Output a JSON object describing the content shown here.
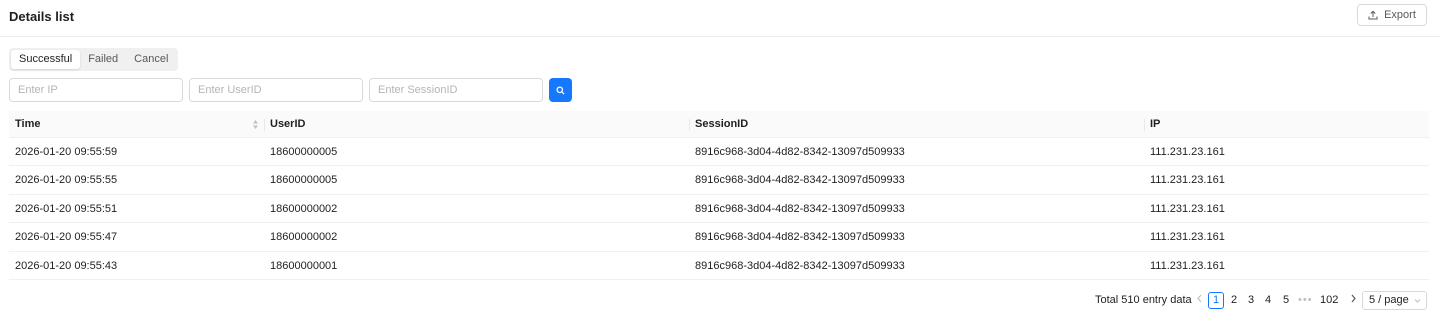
{
  "header": {
    "title": "Details list",
    "export_label": "Export"
  },
  "segmented": [
    {
      "label": "Successful",
      "active": true
    },
    {
      "label": "Failed",
      "active": false
    },
    {
      "label": "Cancel",
      "active": false
    }
  ],
  "filters": {
    "ip_placeholder": "Enter IP",
    "userid_placeholder": "Enter UserID",
    "sessionid_placeholder": "Enter SessionID"
  },
  "table": {
    "columns": [
      "Time",
      "UserID",
      "SessionID",
      "IP"
    ],
    "rows": [
      [
        "2026-01-20 09:55:59",
        "18600000005",
        "8916c968-3d04-4d82-8342-13097d509933",
        "111.231.23.161"
      ],
      [
        "2026-01-20 09:55:55",
        "18600000005",
        "8916c968-3d04-4d82-8342-13097d509933",
        "111.231.23.161"
      ],
      [
        "2026-01-20 09:55:51",
        "18600000002",
        "8916c968-3d04-4d82-8342-13097d509933",
        "111.231.23.161"
      ],
      [
        "2026-01-20 09:55:47",
        "18600000002",
        "8916c968-3d04-4d82-8342-13097d509933",
        "111.231.23.161"
      ],
      [
        "2026-01-20 09:55:43",
        "18600000001",
        "8916c968-3d04-4d82-8342-13097d509933",
        "111.231.23.161"
      ]
    ]
  },
  "pagination": {
    "total_text": "Total 510 entry data",
    "pages": [
      "1",
      "2",
      "3",
      "4",
      "5"
    ],
    "current": "1",
    "ellipsis": "•••",
    "last_page": "102",
    "page_size": "5 / page"
  },
  "colors": {
    "accent": "#1677ff",
    "border": "#d9d9d9",
    "header_bg": "#fafafa"
  }
}
